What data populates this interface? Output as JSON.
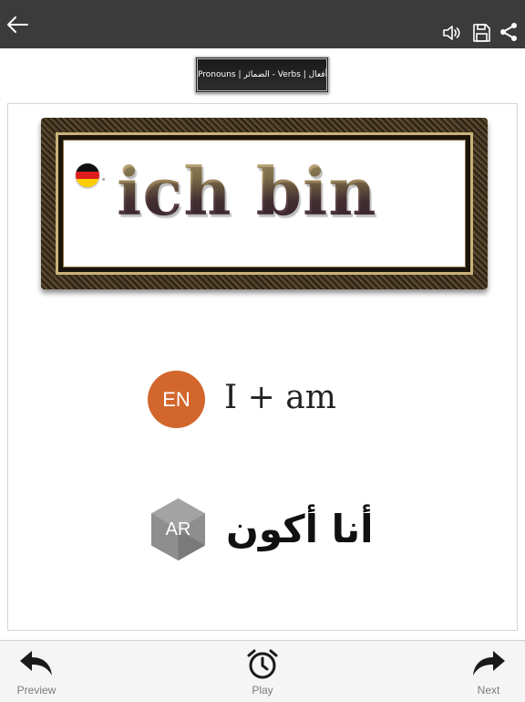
{
  "topbar": {
    "back_icon": "arrow-left-icon",
    "speaker_icon": "speaker-icon",
    "save_icon": "floppy-disk-icon",
    "share_icon": "share-icon",
    "background": "#3b3b3b"
  },
  "category": {
    "label": "Pronouns | الضمائر - Verbs | أفعال"
  },
  "card": {
    "german_word": "ich bin",
    "german_flag_icon": "germany-flag-icon",
    "english_badge": "EN",
    "english_text": "I + am",
    "arabic_badge": "AR",
    "arabic_text": "أنا أكون",
    "english_badge_color": "#d2662d",
    "arabic_badge_color": "#8e8e8e"
  },
  "bottombar": {
    "preview_label": "Preview",
    "play_label": "Play",
    "next_label": "Next",
    "preview_icon": "undo-arrow-icon",
    "play_icon": "alarm-clock-icon",
    "next_icon": "redo-arrow-icon"
  }
}
